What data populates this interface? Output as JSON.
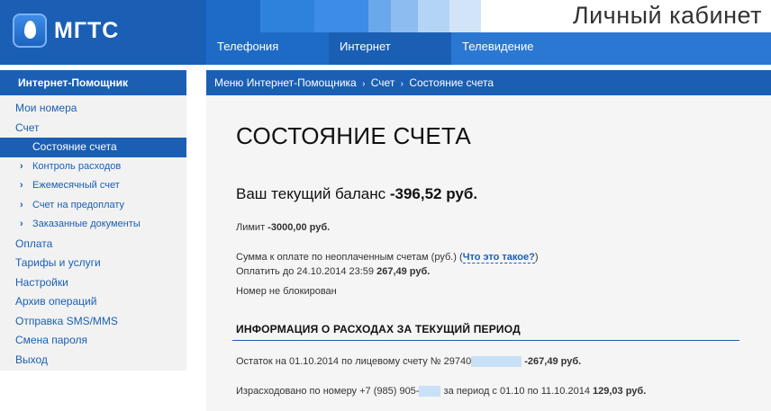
{
  "header": {
    "logo_text": "МГТС",
    "brand_title": "Личный кабинет",
    "nav": [
      "Телефония",
      "Интернет",
      "Телевидение"
    ],
    "colors": {
      "brand_blue": "#1a5fb4",
      "nav_blue": "#2a78d2"
    }
  },
  "sidebar": {
    "title": "Интернет-Помощник",
    "items": [
      {
        "label": "Мои номера",
        "level": 0
      },
      {
        "label": "Счет",
        "level": 0
      },
      {
        "label": "Состояние счета",
        "level": 1,
        "active": true
      },
      {
        "label": "Контроль расходов",
        "level": 1
      },
      {
        "label": "Ежемесячный счет",
        "level": 1
      },
      {
        "label": "Счет на предоплату",
        "level": 1
      },
      {
        "label": "Заказанные документы",
        "level": 1
      },
      {
        "label": "Оплата",
        "level": 0
      },
      {
        "label": "Тарифы и услуги",
        "level": 0
      },
      {
        "label": "Настройки",
        "level": 0
      },
      {
        "label": "Архив операций",
        "level": 0
      },
      {
        "label": "Отправка SMS/MMS",
        "level": 0
      },
      {
        "label": "Смена пароля",
        "level": 0
      },
      {
        "label": "Выход",
        "level": 0
      }
    ]
  },
  "breadcrumb": [
    "Меню Интернет-Помощника",
    "Счет",
    "Состояние счета"
  ],
  "main": {
    "title": "СОСТОЯНИЕ СЧЕТА",
    "balance_label": "Ваш текущий баланс",
    "balance_value": "-396,52 руб.",
    "limit_label": "Лимит",
    "limit_value": "-3000,00 руб.",
    "unpaid_label": "Сумма к оплате по неоплаченным счетам (руб.)",
    "unpaid_link": "Что это такое?",
    "pay_until_label": "Оплатить до 24.10.2014 23:59",
    "pay_until_value": "267,49 руб.",
    "status": "Номер не блокирован",
    "section_title": "ИНФОРМАЦИЯ О РАСХОДАХ ЗА ТЕКУЩИЙ ПЕРИОД",
    "row1_prefix": "Остаток на 01.10.2014 по лицевому счету № 29740",
    "row1_value": "-267,49 руб.",
    "row2_prefix": "Израсходовано по номеру +7 (985) 905-",
    "row2_suffix": "за период с 01.10 по 11.10.2014",
    "row2_value": "129,03 руб."
  }
}
